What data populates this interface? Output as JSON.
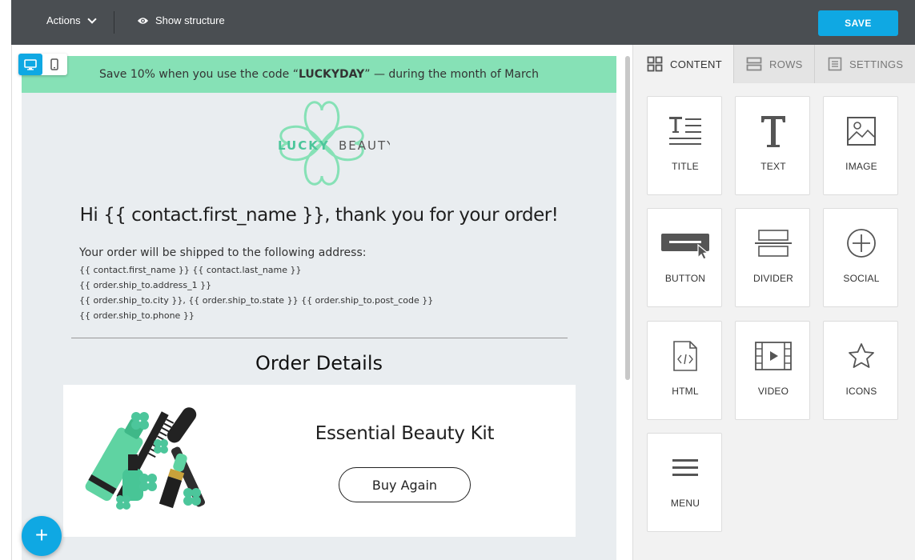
{
  "toolbar": {
    "actions_label": "Actions",
    "show_structure_label": "Show structure",
    "save_label": "SAVE"
  },
  "email": {
    "promo_prefix": "Save 10% when you use the code “",
    "promo_code": "LUCKYDAY",
    "promo_suffix": "” — during the month of March",
    "logo_lucky": "LUCKY",
    "logo_beauty": "BEAUTY",
    "greeting": "Hi {{ contact.first_name }}, thank you for your order!",
    "address_lead": "Your order will be shipped to the following address:",
    "address_lines": [
      "{{ contact.first_name }} {{ contact.last_name }}",
      "{{ order.ship_to.address_1 }}",
      "{{ order.ship_to.city }}, {{ order.ship_to.state }} {{ order.ship_to.post_code }}",
      "{{ order.ship_to.phone }}"
    ],
    "order_details_title": "Order Details",
    "product_name": "Essential Beauty Kit",
    "buy_again_label": "Buy Again"
  },
  "fab_label": "+",
  "panel": {
    "tabs": [
      {
        "label": "CONTENT",
        "icon": "grid-icon",
        "active": true
      },
      {
        "label": "ROWS",
        "icon": "rows-icon",
        "active": false
      },
      {
        "label": "SETTINGS",
        "icon": "settings-icon",
        "active": false
      }
    ],
    "blocks": [
      {
        "label": "TITLE",
        "icon": "title-icon"
      },
      {
        "label": "TEXT",
        "icon": "text-icon"
      },
      {
        "label": "IMAGE",
        "icon": "image-icon"
      },
      {
        "label": "BUTTON",
        "icon": "button-icon"
      },
      {
        "label": "DIVIDER",
        "icon": "divider-icon"
      },
      {
        "label": "SOCIAL",
        "icon": "social-icon"
      },
      {
        "label": "HTML",
        "icon": "html-icon"
      },
      {
        "label": "VIDEO",
        "icon": "video-icon"
      },
      {
        "label": "ICONS",
        "icon": "star-icon"
      },
      {
        "label": "MENU",
        "icon": "menu-icon"
      }
    ]
  },
  "colors": {
    "accent": "#0fa8e3",
    "topbar": "#4a4e52",
    "promo_bg": "#86e1b6",
    "logo_green": "#4cc69b",
    "email_bg": "#e9edf0"
  }
}
